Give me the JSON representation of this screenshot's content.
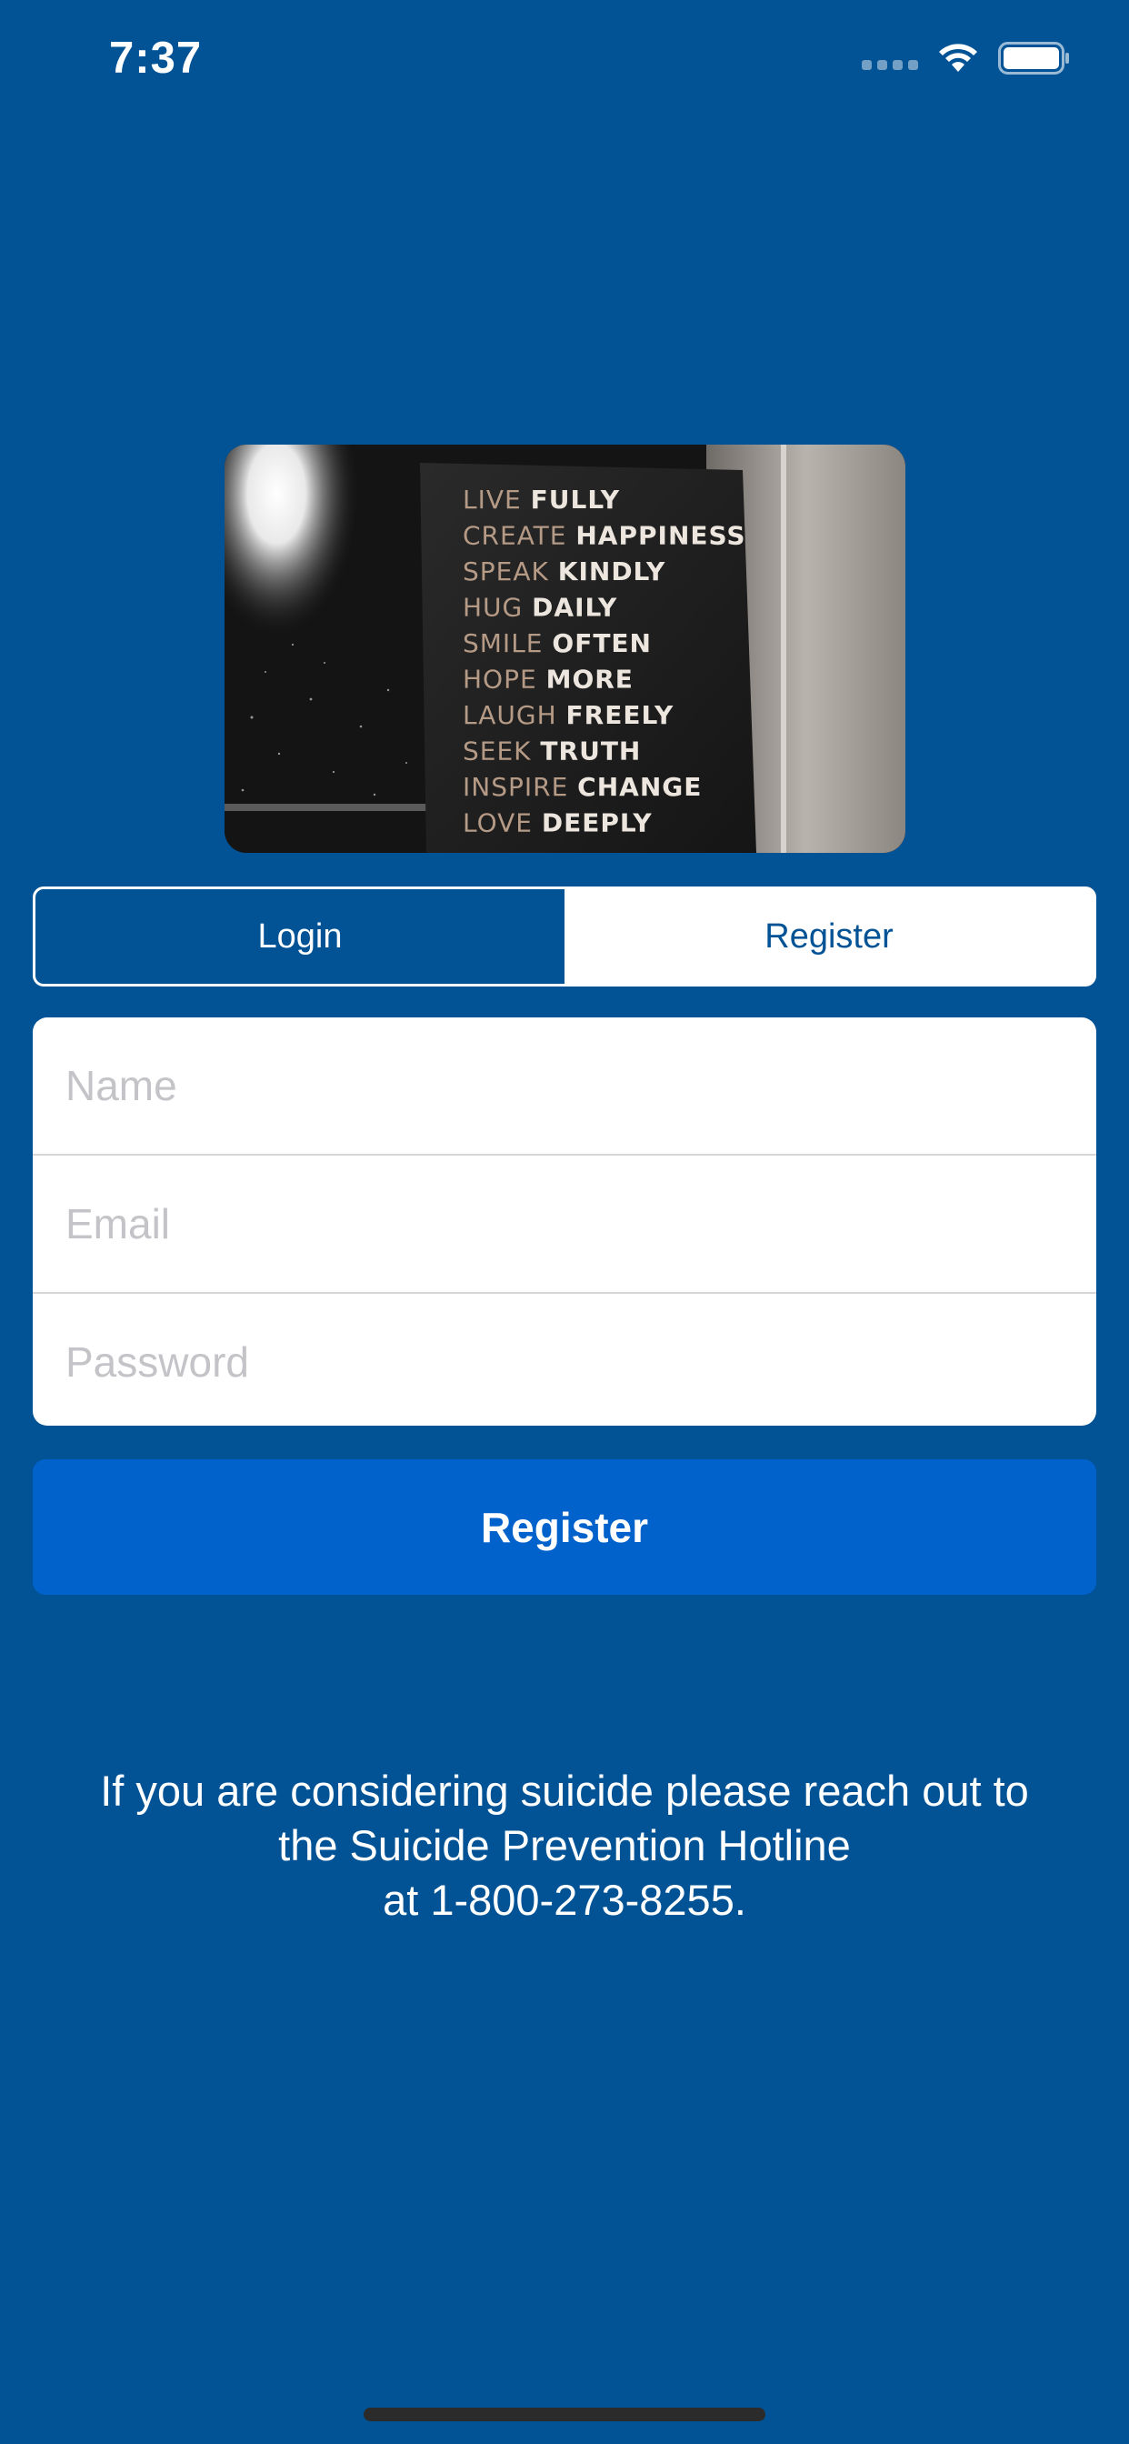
{
  "status_bar": {
    "time": "7:37",
    "icons": [
      "signal-dots-icon",
      "wifi-icon",
      "battery-icon"
    ]
  },
  "hero_image": {
    "description_icon": "quote-sign-photo",
    "quote_lines": [
      {
        "prefix": "LIVE",
        "word": "FULLY"
      },
      {
        "prefix": "CREATE",
        "word": "HAPPINESS"
      },
      {
        "prefix": "SPEAK",
        "word": "KINDLY"
      },
      {
        "prefix": "HUG",
        "word": "DAILY"
      },
      {
        "prefix": "SMILE",
        "word": "OFTEN"
      },
      {
        "prefix": "HOPE",
        "word": "MORE"
      },
      {
        "prefix": "LAUGH",
        "word": "FREELY"
      },
      {
        "prefix": "SEEK",
        "word": "TRUTH"
      },
      {
        "prefix": "INSPIRE",
        "word": "CHANGE"
      },
      {
        "prefix": "LOVE",
        "word": "DEEPLY"
      }
    ]
  },
  "segment": {
    "login_label": "Login",
    "register_label": "Register",
    "selected": "Login"
  },
  "form": {
    "name_placeholder": "Name",
    "name_value": "",
    "email_placeholder": "Email",
    "email_value": "",
    "password_placeholder": "Password",
    "password_value": ""
  },
  "register_button": {
    "label": "Register"
  },
  "hotline": {
    "line1": "If you are considering suicide please reach out to",
    "line2": "the Suicide Prevention Hotline",
    "line3": "at 1-800-273-8255."
  },
  "colors": {
    "background": "#025396",
    "button": "#0262cb",
    "segment_selected": "#025396",
    "segment_unselected": "#ffffff",
    "placeholder": "#c4c4c8"
  }
}
